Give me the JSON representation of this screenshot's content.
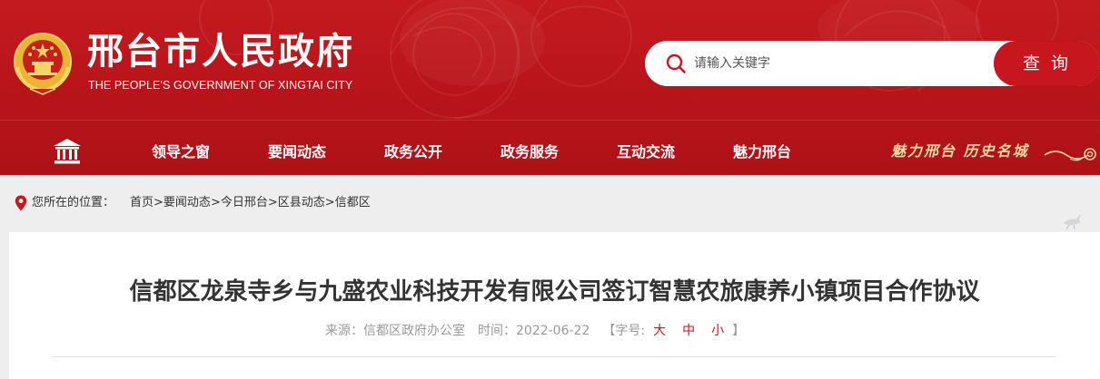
{
  "header": {
    "title": "邢台市人民政府",
    "subtitle": "THE PEOPLE'S GOVERNMENT OF XINGTAI CITY",
    "emblem_icon": "national-emblem-icon",
    "brand_color": "#c41a1f"
  },
  "search": {
    "placeholder": "请输入关键字",
    "button_label": "查 询",
    "icon": "search-icon"
  },
  "nav": {
    "home_icon": "government-building-icon",
    "items": [
      {
        "label": "领导之窗"
      },
      {
        "label": "要闻动态"
      },
      {
        "label": "政务公开"
      },
      {
        "label": "政务服务"
      },
      {
        "label": "互动交流"
      },
      {
        "label": "魅力邢台"
      }
    ],
    "slogan": "魅力邢台 历史名城"
  },
  "breadcrumb": {
    "label": "您所在的位置：",
    "icon": "location-pin-icon",
    "items": [
      {
        "label": "首页"
      },
      {
        "label": "要闻动态"
      },
      {
        "label": "今日邢台"
      },
      {
        "label": "区县动态"
      },
      {
        "label": "信都区"
      }
    ],
    "separator": ">"
  },
  "article": {
    "title": "信都区龙泉寺乡与九盛农业科技开发有限公司签订智慧农旅康养小镇项目合作协议",
    "source_label": "来源：",
    "source": "信都区政府办公室",
    "time_label": "时间：",
    "time": "2022-06-22",
    "font_size_label": "【字号:",
    "font_size_end": "】",
    "font_sizes": {
      "large": "大",
      "medium": "中",
      "small": "小"
    }
  },
  "colors": {
    "accent": "#c8161e",
    "slogan": "#f3d9a6"
  }
}
